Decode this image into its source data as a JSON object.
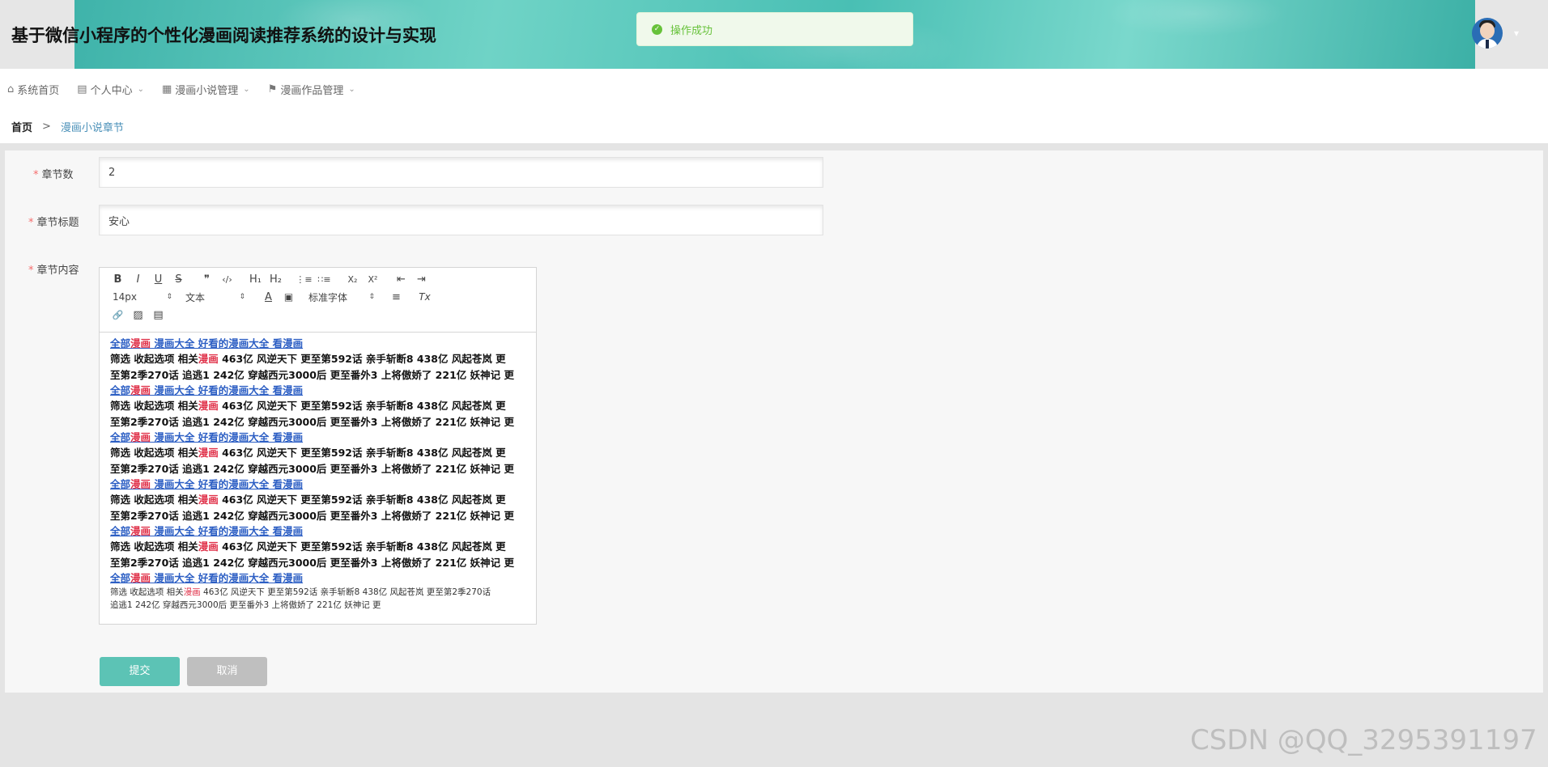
{
  "header": {
    "title": "基于微信小程序的个性化漫画阅读推荐系统的设计与实现",
    "avatar_caret": "▾"
  },
  "toast": {
    "icon": "✓",
    "message": "操作成功"
  },
  "nav": {
    "items": [
      {
        "icon": "⌂",
        "label": "系统首页",
        "caret": ""
      },
      {
        "icon": "▤",
        "label": "个人中心",
        "caret": "⌄"
      },
      {
        "icon": "▦",
        "label": "漫画小说管理",
        "caret": "⌄"
      },
      {
        "icon": "⚑",
        "label": "漫画作品管理",
        "caret": "⌄"
      }
    ]
  },
  "breadcrumb": {
    "home": "首页",
    "separator": ">",
    "current": "漫画小说章节"
  },
  "form": {
    "required_mark": "*",
    "chapter_num": {
      "label": "章节数",
      "value": "2"
    },
    "chapter_title": {
      "label": "章节标题",
      "value": "安心"
    },
    "chapter_content": {
      "label": "章节内容"
    },
    "submit_label": "提交",
    "cancel_label": "取消"
  },
  "editor": {
    "toolbar": {
      "bold": "B",
      "italic": "I",
      "underline": "U",
      "strike": "S",
      "quote": "❞",
      "code": "‹/›",
      "h1": "H₁",
      "h2": "H₂",
      "ordered_list": "⋮≡",
      "bullet_list": "∷≡",
      "subscript": "X₂",
      "superscript": "X²",
      "outdent": "⇤",
      "indent": "⇥",
      "font_size": "14px",
      "font_kind": "文本",
      "font_family": "标准字体",
      "select_arrows": "⇕",
      "font_color": "A",
      "background": "▣",
      "align": "≡",
      "clean": "Tx",
      "link": "🔗",
      "image": "▨",
      "video": "▤"
    },
    "content": {
      "link_line": {
        "prefix": "全部",
        "highlight": "漫画",
        "rest": " 漫画大全 好看的漫画大全 看漫画"
      },
      "body_line1": {
        "prefix": "筛选 收起选项 相关",
        "highlight": "漫画",
        "rest": " 463亿 风逆天下 更至第592话 亲手斩断8 438亿 风起苍岚 更"
      },
      "body_line2": "至第2季270话 追逃1 242亿 穿越西元3000后 更至番外3 上将傲娇了 221亿 妖神记 更",
      "small_line1": {
        "prefix": "筛选 收起选项 相关",
        "highlight": "漫画",
        "rest": " 463亿 风逆天下 更至第592话 亲手斩断8 438亿 风起苍岚 更至第2季270话"
      },
      "small_line2": "追逃1 242亿 穿越西元3000后 更至番外3 上将傲娇了 221亿 妖神记 更"
    }
  },
  "watermark": "CSDN @QQ_3295391197"
}
